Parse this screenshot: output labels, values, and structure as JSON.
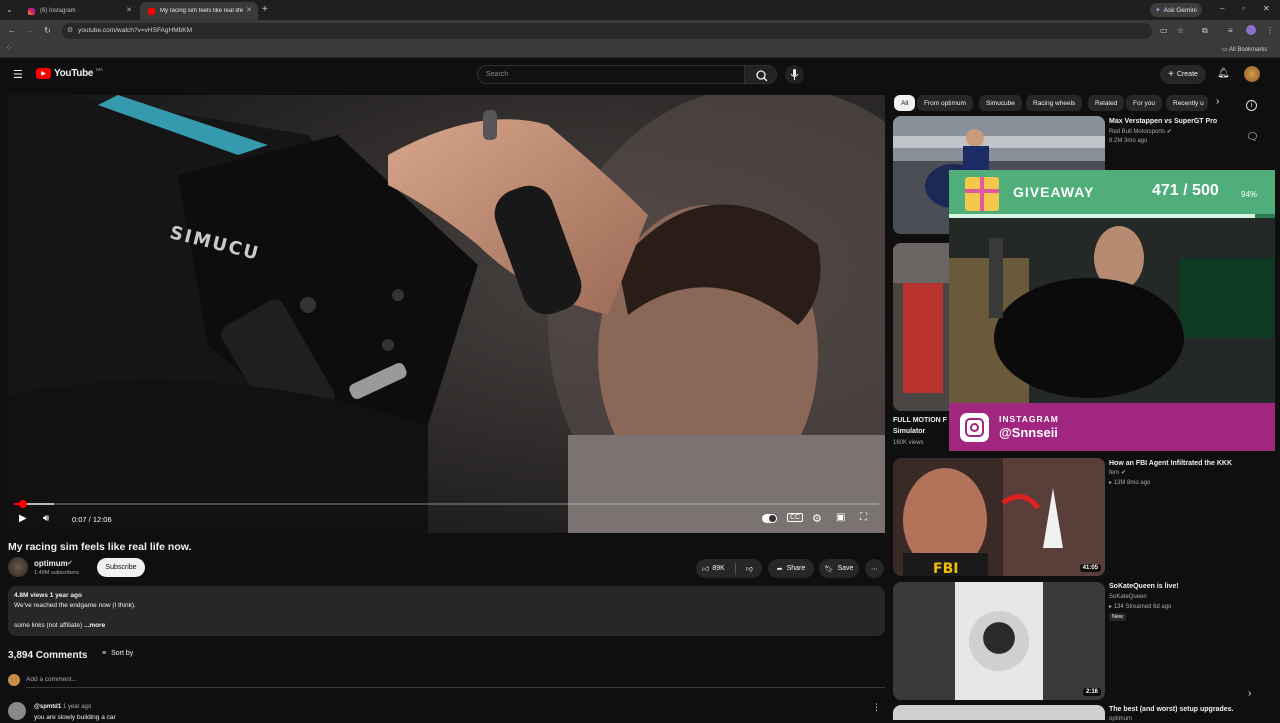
{
  "browser": {
    "tabs": [
      {
        "label": "(6) Instagram",
        "active": false
      },
      {
        "label": "My racing sim feels like real life",
        "active": true
      }
    ],
    "url": "youtube.com/watch?v=vHSFAgHMbKM",
    "ask_gemini": "Ask Gemini",
    "all_bookmarks": "All Bookmarks"
  },
  "header": {
    "logo": "YouTube",
    "logo_superscript": "MA",
    "search_placeholder": "Search",
    "create_label": "Create"
  },
  "player": {
    "time": "0:07 / 12:06",
    "progress_fraction": 0.01,
    "watermark_text": "SIMUCU"
  },
  "video": {
    "title": "My racing sim feels like real life now.",
    "channel": "optimum",
    "subscribers": "1.49M subscribers",
    "subscribe_label": "Subscribe",
    "likes": "89K",
    "share_label": "Share",
    "save_label": "Save",
    "views_date": "4.8M views  1 year ago",
    "desc_line1": "We've reached the endgame now (I think).",
    "desc_line2": "some links (not affiliate)",
    "more_label": "...more"
  },
  "comments": {
    "count": "3,894 Comments",
    "sort_label": "Sort by",
    "add_placeholder": "Add a comment...",
    "first_author": "@spmtd1",
    "first_time": "1 year ago",
    "first_text": "you are slowly building a car"
  },
  "chips": [
    "All",
    "From optimum",
    "Simucube",
    "Racing wheels",
    "Related",
    "For you",
    "Recently u"
  ],
  "recommendations": [
    {
      "title": "Max Verstappen vs SuperGT Pro",
      "channel": "Red Bull Motorsports",
      "meta": "8.2M  3mo ago"
    },
    {
      "title": "FULL MOTION F",
      "title2": "Simulator",
      "meta": "160K views"
    },
    {
      "title": "How an FBI Agent Infiltrated the KKK",
      "channel": "fern",
      "meta": "13M  8mo ago",
      "duration": "41:05",
      "thumb_text": "FBI"
    },
    {
      "title": "SoKateQueen is live!",
      "channel": "SoKateQueen",
      "meta": "134  Streamed 6d ago",
      "badge": "New",
      "duration": "2:16"
    },
    {
      "title": "The best (and worst) setup upgrades.",
      "channel": "optimum"
    }
  ],
  "overlay": {
    "giveaway_label": "GIVEAWAY",
    "giveaway_count": "471",
    "giveaway_total": "500",
    "giveaway_percent": "94%",
    "giveaway_fraction": 0.94,
    "insta_label": "INSTAGRAM",
    "insta_handle": "@Snnseii"
  },
  "colors": {
    "youtube_red": "#ff0000",
    "giveaway_green": "#4fae79",
    "insta_magenta": "#a0267f"
  }
}
